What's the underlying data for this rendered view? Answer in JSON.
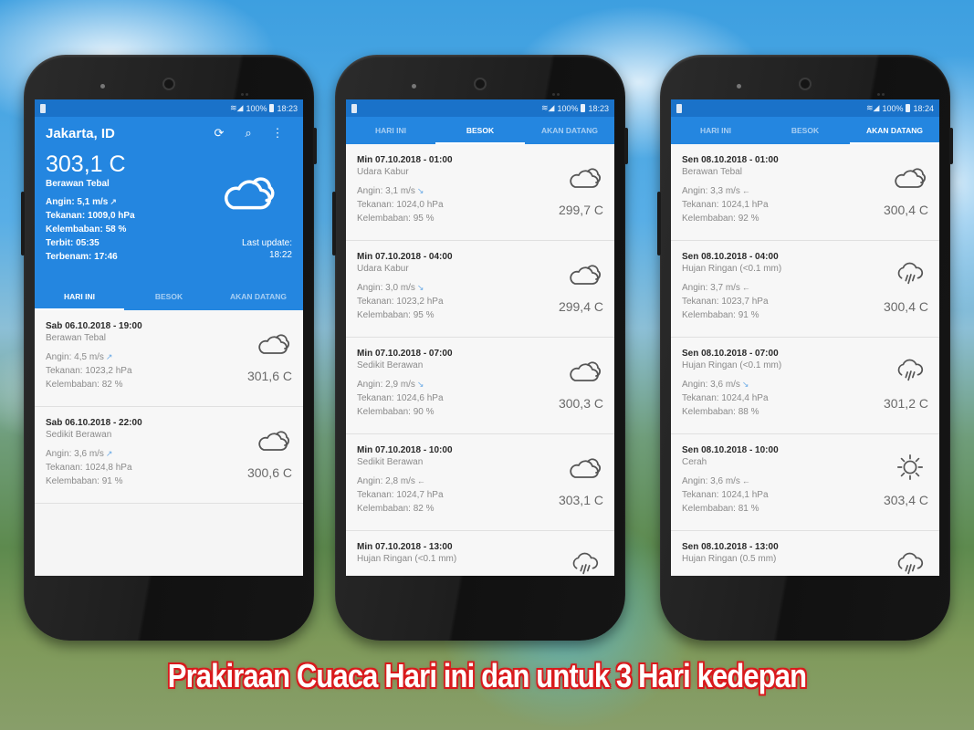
{
  "caption": "Prakiraan Cuaca Hari ini dan untuk 3 Hari kedepan",
  "tabs": [
    "HARI INI",
    "BESOK",
    "AKAN DATANG"
  ],
  "phones": [
    {
      "status": {
        "signal": "100%",
        "time": "18:23"
      },
      "active_tab": 0,
      "toolbar": {
        "title": "Jakarta, ID",
        "icons": [
          "refresh-icon",
          "search-icon",
          "more-vert-icon"
        ]
      },
      "current": {
        "temp": "303,1 C",
        "desc": "Berawan Tebal",
        "wind": "Angin: 5,1 m/s",
        "pressure": "Tekanan: 1009,0 hPa",
        "humidity": "Kelembaban: 58 %",
        "sunrise": "Terbit: 05:35",
        "sunset": "Terbenam: 17:46",
        "last_update_label": "Last update:",
        "last_update_time": "18:22",
        "icon": "cloudy-icon"
      },
      "items": [
        {
          "datetime": "Sab 06.10.2018 - 19:00",
          "desc": "Berawan Tebal",
          "wind": "Angin: 4,5 m/s",
          "wind_dir": "↗",
          "pressure": "Tekanan: 1023,2 hPa",
          "humidity": "Kelembaban: 82 %",
          "temp": "301,6 C",
          "icon": "cloudy-icon"
        },
        {
          "datetime": "Sab 06.10.2018 - 22:00",
          "desc": "Sedikit Berawan",
          "wind": "Angin: 3,6 m/s",
          "wind_dir": "↗",
          "pressure": "Tekanan: 1024,8 hPa",
          "humidity": "Kelembaban: 91 %",
          "temp": "300,6 C",
          "icon": "cloudy-icon"
        }
      ]
    },
    {
      "status": {
        "signal": "100%",
        "time": "18:23"
      },
      "active_tab": 1,
      "items": [
        {
          "datetime": "Min 07.10.2018 - 01:00",
          "desc": "Udara Kabur",
          "wind": "Angin: 3,1 m/s",
          "wind_dir": "↘",
          "pressure": "Tekanan: 1024,0 hPa",
          "humidity": "Kelembaban: 95 %",
          "temp": "299,7 C",
          "icon": "cloudy-icon"
        },
        {
          "datetime": "Min 07.10.2018 - 04:00",
          "desc": "Udara Kabur",
          "wind": "Angin: 3,0 m/s",
          "wind_dir": "↘",
          "pressure": "Tekanan: 1023,2 hPa",
          "humidity": "Kelembaban: 95 %",
          "temp": "299,4 C",
          "icon": "cloudy-icon"
        },
        {
          "datetime": "Min 07.10.2018 - 07:00",
          "desc": "Sedikit Berawan",
          "wind": "Angin: 2,9 m/s",
          "wind_dir": "↘",
          "pressure": "Tekanan: 1024,6 hPa",
          "humidity": "Kelembaban: 90 %",
          "temp": "300,3 C",
          "icon": "cloudy-icon"
        },
        {
          "datetime": "Min 07.10.2018 - 10:00",
          "desc": "Sedikit Berawan",
          "wind": "Angin: 2,8 m/s",
          "wind_dir": "←",
          "pressure": "Tekanan: 1024,7 hPa",
          "humidity": "Kelembaban: 82 %",
          "temp": "303,1 C",
          "icon": "cloudy-icon"
        },
        {
          "datetime": "Min 07.10.2018 - 13:00",
          "desc": "Hujan Ringan (<0.1 mm)",
          "wind": "",
          "wind_dir": "",
          "pressure": "",
          "humidity": "",
          "temp": "",
          "icon": "rain-icon"
        }
      ]
    },
    {
      "status": {
        "signal": "100%",
        "time": "18:24"
      },
      "active_tab": 2,
      "items": [
        {
          "datetime": "Sen 08.10.2018 - 01:00",
          "desc": "Berawan Tebal",
          "wind": "Angin: 3,3 m/s",
          "wind_dir": "←",
          "pressure": "Tekanan: 1024,1 hPa",
          "humidity": "Kelembaban: 92 %",
          "temp": "300,4 C",
          "icon": "cloudy-icon"
        },
        {
          "datetime": "Sen 08.10.2018 - 04:00",
          "desc": "Hujan Ringan (<0.1 mm)",
          "wind": "Angin: 3,7 m/s",
          "wind_dir": "←",
          "pressure": "Tekanan: 1023,7 hPa",
          "humidity": "Kelembaban: 91 %",
          "temp": "300,4 C",
          "icon": "rain-icon"
        },
        {
          "datetime": "Sen 08.10.2018 - 07:00",
          "desc": "Hujan Ringan (<0.1 mm)",
          "wind": "Angin: 3,6 m/s",
          "wind_dir": "↘",
          "pressure": "Tekanan: 1024,4 hPa",
          "humidity": "Kelembaban: 88 %",
          "temp": "301,2 C",
          "icon": "rain-icon"
        },
        {
          "datetime": "Sen 08.10.2018 - 10:00",
          "desc": "Cerah",
          "wind": "Angin: 3,6 m/s",
          "wind_dir": "←",
          "pressure": "Tekanan: 1024,1 hPa",
          "humidity": "Kelembaban: 81 %",
          "temp": "303,4 C",
          "icon": "sun-icon"
        },
        {
          "datetime": "Sen 08.10.2018 - 13:00",
          "desc": "Hujan Ringan (0.5 mm)",
          "wind": "",
          "wind_dir": "",
          "pressure": "",
          "humidity": "",
          "temp": "",
          "icon": "rain-icon"
        }
      ]
    }
  ]
}
